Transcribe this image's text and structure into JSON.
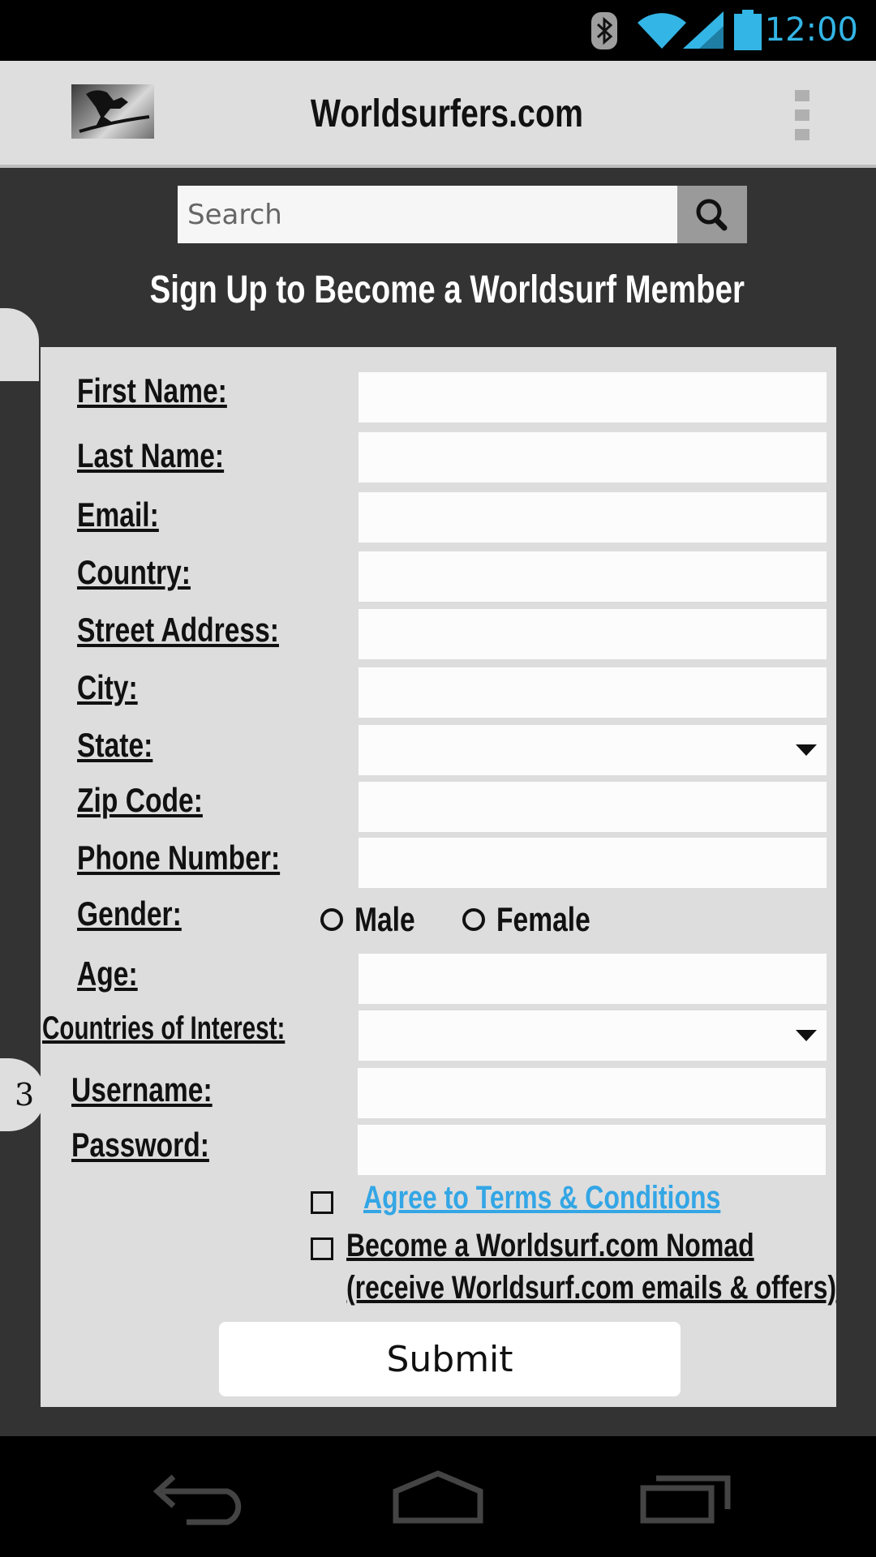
{
  "status_bar": {
    "time": "12:00",
    "accent_color": "#33b5e5",
    "icons": [
      "bluetooth-icon",
      "wifi-icon",
      "signal-icon",
      "battery-icon"
    ]
  },
  "app_bar": {
    "title": "Worldsurfers.com",
    "logo_icon": "surfer-logo",
    "menu_icon": "overflow-menu-icon"
  },
  "search": {
    "placeholder": "Search",
    "icon": "search-icon"
  },
  "page_heading": "Sign Up to Become a Worldsurf Member",
  "side_label": "3",
  "form": {
    "first_name_label": "First Name:",
    "last_name_label": "Last Name:",
    "email_label": "Email:",
    "country_label": "Country:",
    "street_label": "Street Address:",
    "city_label": "City:",
    "state_label": "State:",
    "zip_label": "Zip Code:",
    "phone_label": "Phone Number:",
    "gender_label": "Gender:",
    "gender_male": "Male",
    "gender_female": "Female",
    "age_label": "Age:",
    "countries_label": "Countries of Interest:",
    "username_label": "Username:",
    "password_label": "Password:",
    "terms_label": "Agree to Terms & Conditions",
    "nomad_line1": "Become a Worldsurf.com Nomad ",
    "nomad_line2": "(receive Worldsurf.com emails & offers)",
    "submit_label": "Submit",
    "link_color": "#33a6e5"
  },
  "nav_bar": {
    "icons": [
      "back-icon",
      "home-icon",
      "recent-apps-icon"
    ]
  }
}
